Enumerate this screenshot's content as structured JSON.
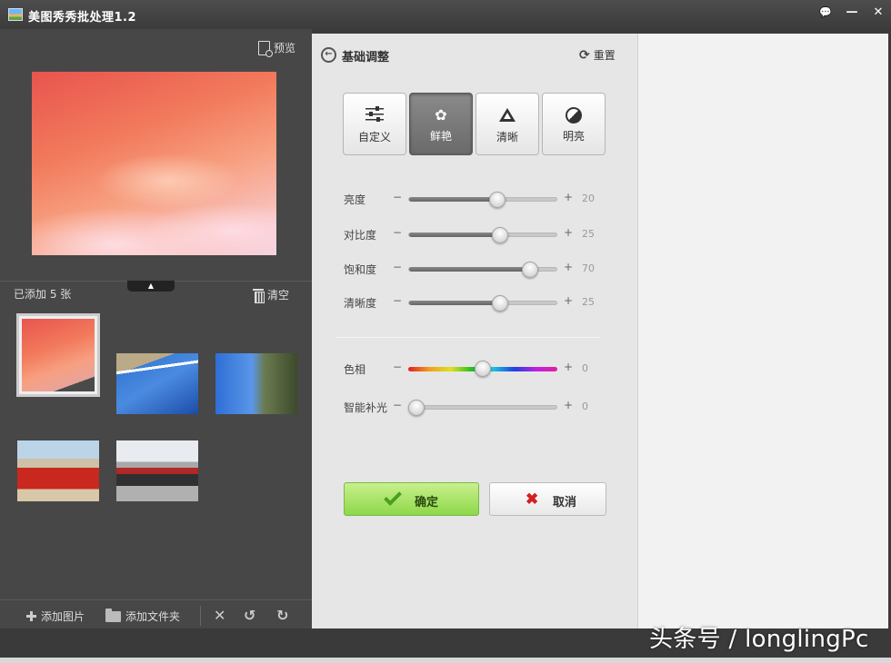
{
  "window": {
    "title": "美图秀秀批处理1.2",
    "buttons": {
      "feedback": "💬",
      "minimize": "—",
      "close": "✕"
    }
  },
  "left_panel": {
    "preview_label": "预览",
    "added_label": "已添加 5 张",
    "clear_label": "清空",
    "collapse_glyph": "▲",
    "toolbar": {
      "add_images": "添加图片",
      "add_folder": "添加文件夹",
      "delete_glyph": "✕",
      "rotate_left_glyph": "↺",
      "rotate_right_glyph": "↻"
    }
  },
  "adjust_panel": {
    "title": "基础调整",
    "back_glyph": "←",
    "reset_label": "重置",
    "reset_glyph": "⟳",
    "modes": [
      {
        "label": "自定义",
        "icon": "sliders-icon",
        "active": false
      },
      {
        "label": "鲜艳",
        "icon": "flower-icon",
        "glyph": "✿",
        "active": true
      },
      {
        "label": "清晰",
        "icon": "triangle-icon",
        "active": false
      },
      {
        "label": "明亮",
        "icon": "half-circle-icon",
        "active": false
      }
    ],
    "sliders": [
      {
        "name": "亮度",
        "value": "20",
        "fraction": 0.59
      },
      {
        "name": "对比度",
        "value": "25",
        "fraction": 0.61
      },
      {
        "name": "饱和度",
        "value": "70",
        "fraction": 0.81
      },
      {
        "name": "清晰度",
        "value": "25",
        "fraction": 0.61
      }
    ],
    "extra_sliders": [
      {
        "name": "色相",
        "value": "0",
        "fraction": 0.5,
        "type": "hue"
      },
      {
        "name": "智能补光",
        "value": "0",
        "fraction": 0.05,
        "type": "normal"
      }
    ],
    "minus": "−",
    "plus": "+",
    "ok_label": "确定",
    "cancel_label": "取消"
  },
  "watermark": "头条号 / longlingPc",
  "colors": {
    "ok_green": "#8ed84a",
    "cancel_red": "#d42020",
    "panel_bg": "#e6e6e6",
    "sidebar_bg": "#474747"
  }
}
